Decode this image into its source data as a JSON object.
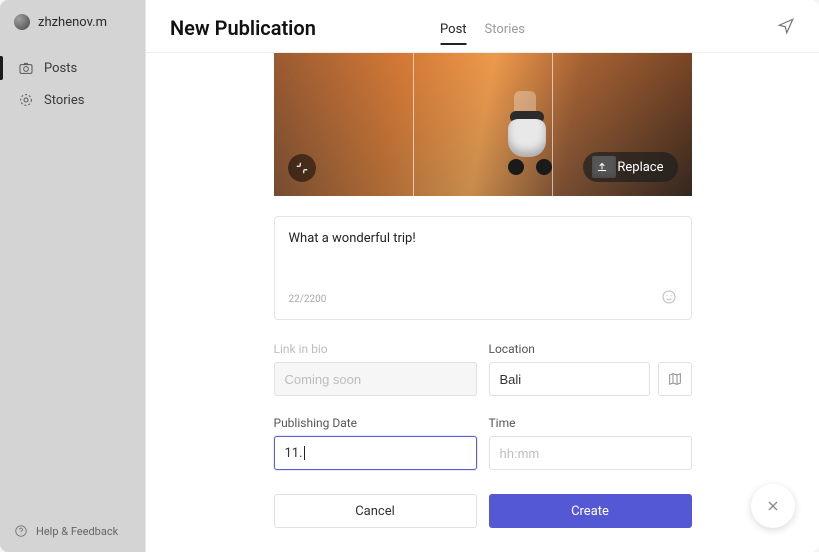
{
  "user": {
    "name": "zhzhenov.m"
  },
  "nav": {
    "posts": "Posts",
    "stories": "Stories"
  },
  "help": "Help & Feedback",
  "header": {
    "title": "New Publication",
    "tabs": {
      "post": "Post",
      "stories": "Stories"
    }
  },
  "image": {
    "replace_label": "Replace"
  },
  "caption": {
    "text": "What a wonderful trip!",
    "counter": "22/2200"
  },
  "fields": {
    "link_label": "Link in bio",
    "link_placeholder": "Coming soon",
    "location_label": "Location",
    "location_value": "Bali",
    "date_label": "Publishing Date",
    "date_value": "11.",
    "time_label": "Time",
    "time_placeholder": "hh:mm"
  },
  "buttons": {
    "cancel": "Cancel",
    "create": "Create"
  }
}
